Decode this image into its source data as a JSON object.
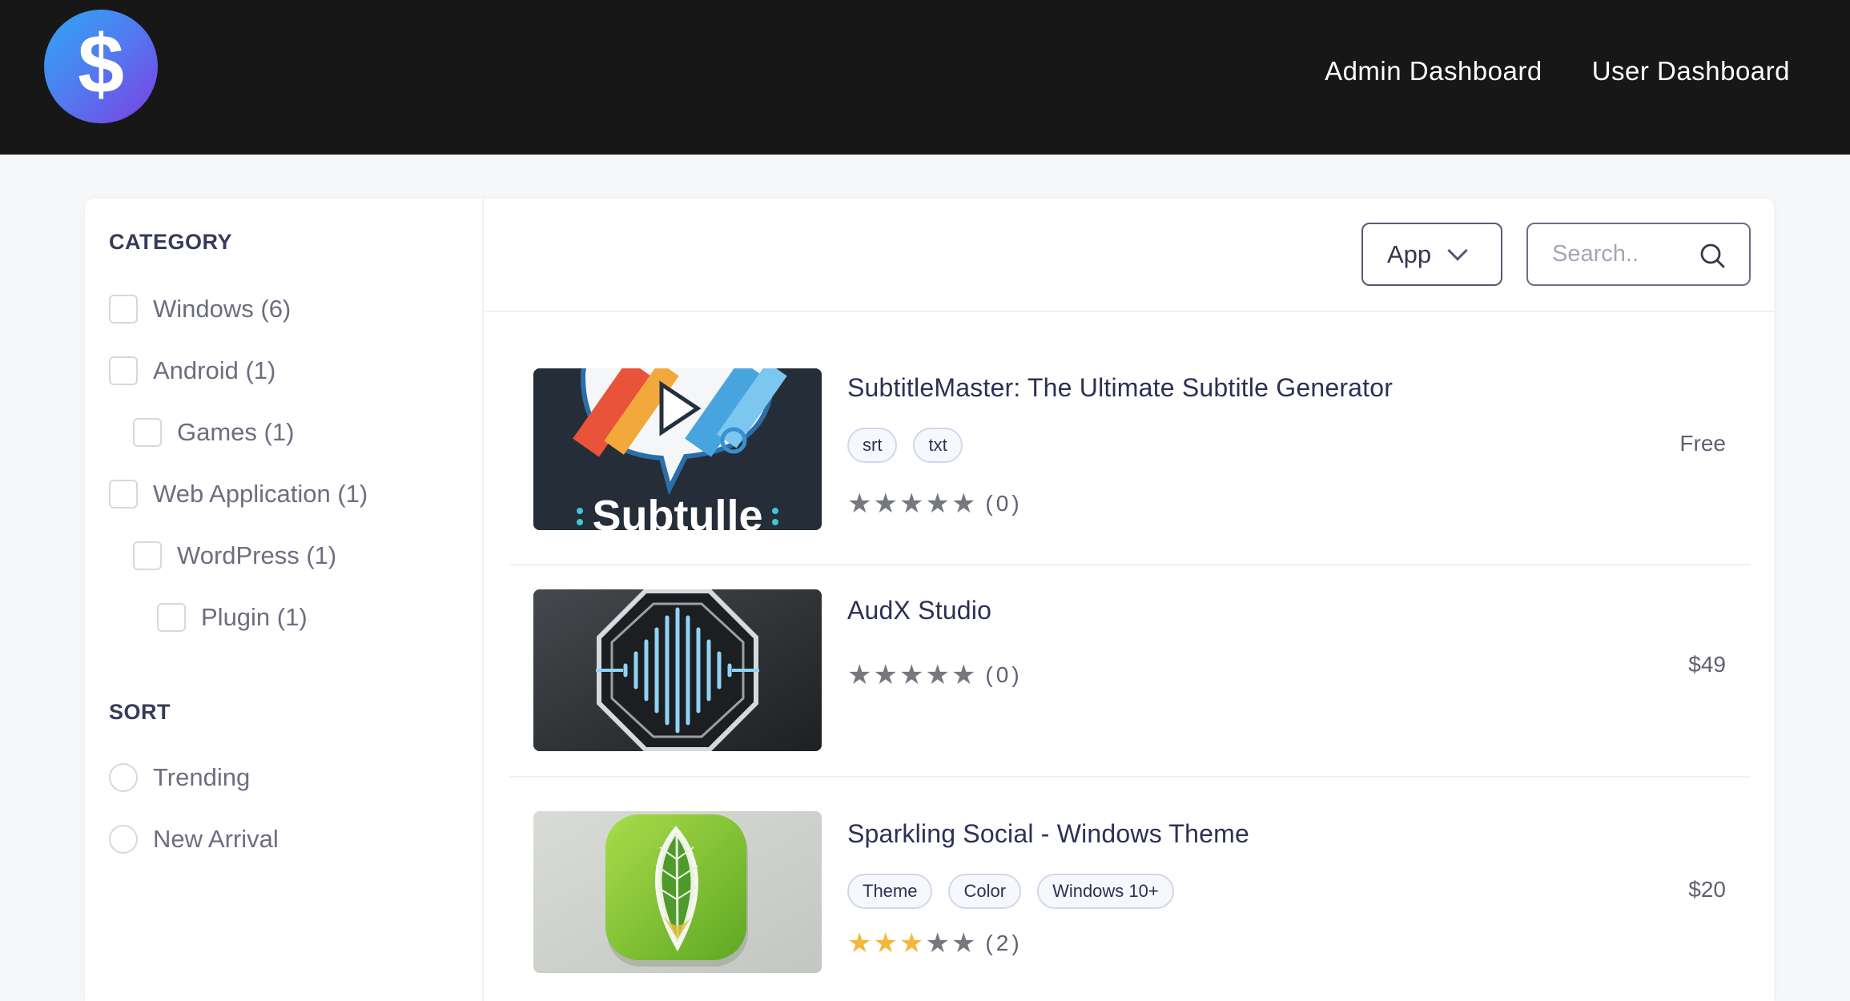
{
  "header": {
    "logo_glyph": "$",
    "nav": [
      "Admin Dashboard",
      "User Dashboard"
    ]
  },
  "sidebar": {
    "category_title": "CATEGORY",
    "categories": [
      {
        "label": "Windows (6)",
        "indent": 0
      },
      {
        "label": "Android (1)",
        "indent": 0
      },
      {
        "label": "Games (1)",
        "indent": 1
      },
      {
        "label": "Web Application (1)",
        "indent": 0
      },
      {
        "label": "WordPress (1)",
        "indent": 1
      },
      {
        "label": "Plugin (1)",
        "indent": 2
      }
    ],
    "sort_title": "SORT",
    "sort_options": [
      "Trending",
      "New Arrival"
    ]
  },
  "toolbar": {
    "type_select": "App",
    "search_placeholder": "Search.."
  },
  "products": [
    {
      "title": "SubtitleMaster: The Ultimate Subtitle Generator",
      "thumb_text": "Subtulle",
      "tags": [
        "srt",
        "txt"
      ],
      "rating": 0,
      "rating_count": "(0)",
      "price": "Free"
    },
    {
      "title": "AudX Studio",
      "tags": [],
      "rating": 0,
      "rating_count": "(0)",
      "price": "$49"
    },
    {
      "title": "Sparkling Social - Windows Theme",
      "tags": [
        "Theme",
        "Color",
        "Windows 10+"
      ],
      "rating": 3,
      "rating_count": "(2)",
      "price": "$20"
    }
  ],
  "colors": {
    "topbar": "#171717",
    "star_filled": "#f4b73c",
    "star_empty": "#76787f",
    "heading": "#2d3056"
  }
}
